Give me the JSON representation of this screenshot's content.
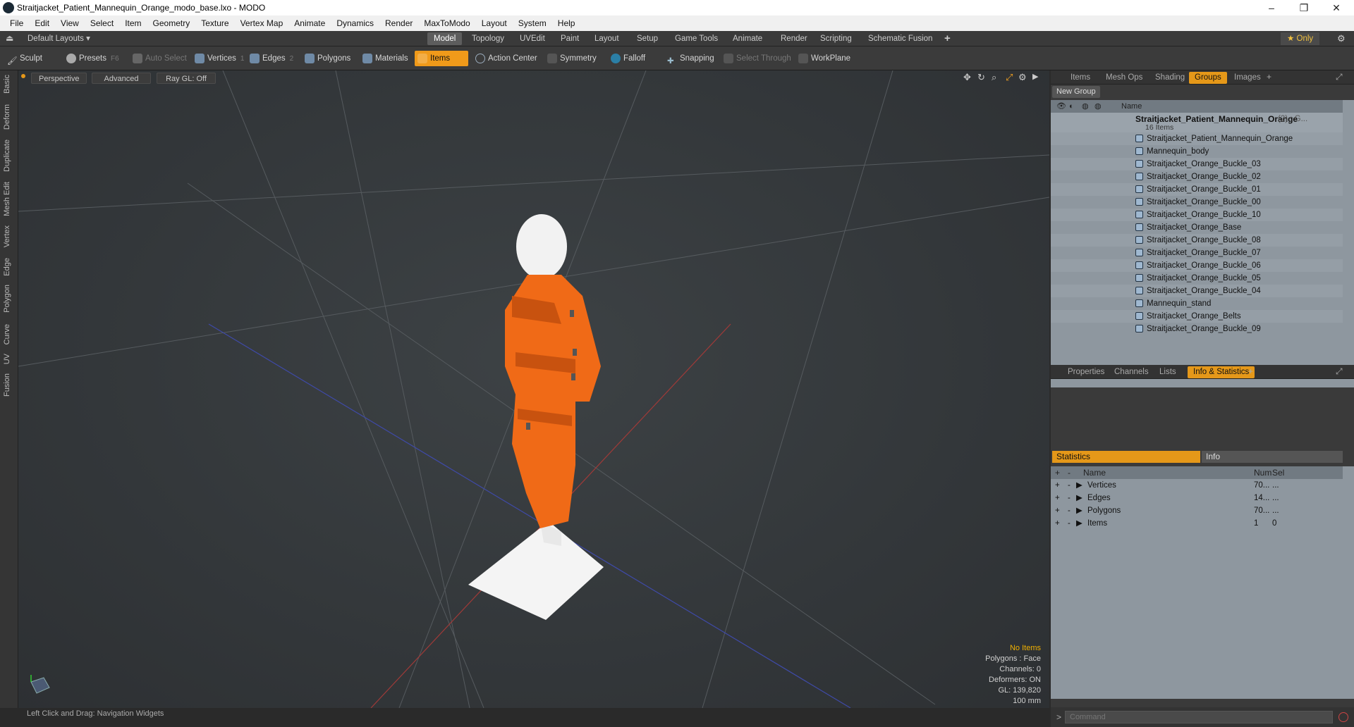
{
  "window": {
    "title": "Straitjacket_Patient_Mannequin_Orange_modo_base.lxo - MODO",
    "minimize": "–",
    "maximize": "❐",
    "close": "✕"
  },
  "menu": [
    "File",
    "Edit",
    "View",
    "Select",
    "Item",
    "Geometry",
    "Texture",
    "Vertex Map",
    "Animate",
    "Dynamics",
    "Render",
    "MaxToModo",
    "Layout",
    "System",
    "Help"
  ],
  "layoutbar": {
    "layouts": "Default Layouts ▾",
    "tabs": [
      "Model",
      "Topology",
      "UVEdit",
      "Paint",
      "Layout",
      "Setup",
      "Game Tools",
      "Animate",
      "Render",
      "Scripting",
      "Schematic Fusion"
    ],
    "add": "+",
    "only": "★ Only"
  },
  "toolbar": {
    "sculpt": "Sculpt",
    "presets": "Presets",
    "presets_key": "F6",
    "auto_select": "Auto Select",
    "vertices": "Vertices",
    "vertices_n": "1",
    "edges": "Edges",
    "edges_n": "2",
    "polygons": "Polygons",
    "materials": "Materials",
    "items": "Items",
    "action_center": "Action Center",
    "symmetry": "Symmetry",
    "falloff": "Falloff",
    "snapping": "Snapping",
    "select_through": "Select Through",
    "workplane": "WorkPlane"
  },
  "lefttabs": [
    "Basic",
    "Deform",
    "Duplicate",
    "Mesh Edit",
    "Vertex",
    "Edge",
    "Polygon",
    "Curve",
    "UV",
    "Fusion"
  ],
  "viewport": {
    "perspective": "Perspective",
    "advanced": "Advanced",
    "raygl": "Ray GL: Off",
    "hud": {
      "no_items": "No Items",
      "polygons": "Polygons : Face",
      "channels": "Channels: 0",
      "deformers": "Deformers: ON",
      "gl": "GL: 139,820",
      "scale": "100 mm"
    }
  },
  "status": {
    "text": "Left Click and Drag:  Navigation Widgets"
  },
  "top_panel": {
    "tabs": [
      "Items",
      "Mesh Ops",
      "Shading",
      "Groups",
      "Images"
    ],
    "new_group": "New Group",
    "name_col": "Name",
    "group": "Straitjacket_Patient_Mannequin_Orange",
    "group_suffix": "(2) : G...",
    "group_count": "16 Items",
    "items": [
      "Straitjacket_Patient_Mannequin_Orange",
      "Mannequin_body",
      "Straitjacket_Orange_Buckle_03",
      "Straitjacket_Orange_Buckle_02",
      "Straitjacket_Orange_Buckle_01",
      "Straitjacket_Orange_Buckle_00",
      "Straitjacket_Orange_Buckle_10",
      "Straitjacket_Orange_Base",
      "Straitjacket_Orange_Buckle_08",
      "Straitjacket_Orange_Buckle_07",
      "Straitjacket_Orange_Buckle_06",
      "Straitjacket_Orange_Buckle_05",
      "Straitjacket_Orange_Buckle_04",
      "Mannequin_stand",
      "Straitjacket_Orange_Belts",
      "Straitjacket_Orange_Buckle_09"
    ]
  },
  "bottom_panel": {
    "tabs": [
      "Properties",
      "Channels",
      "Lists",
      "Info & Statistics"
    ],
    "statistics": "Statistics",
    "info": "Info",
    "cols": {
      "name": "Name",
      "num": "Num",
      "sel": "Sel"
    },
    "rows": [
      {
        "name": "Vertices",
        "num": "70...",
        "sel": "..."
      },
      {
        "name": "Edges",
        "num": "14...",
        "sel": "..."
      },
      {
        "name": "Polygons",
        "num": "70...",
        "sel": "..."
      },
      {
        "name": "Items",
        "num": "1",
        "sel": "0"
      }
    ]
  },
  "command": {
    "prompt": ">",
    "placeholder": "Command"
  }
}
